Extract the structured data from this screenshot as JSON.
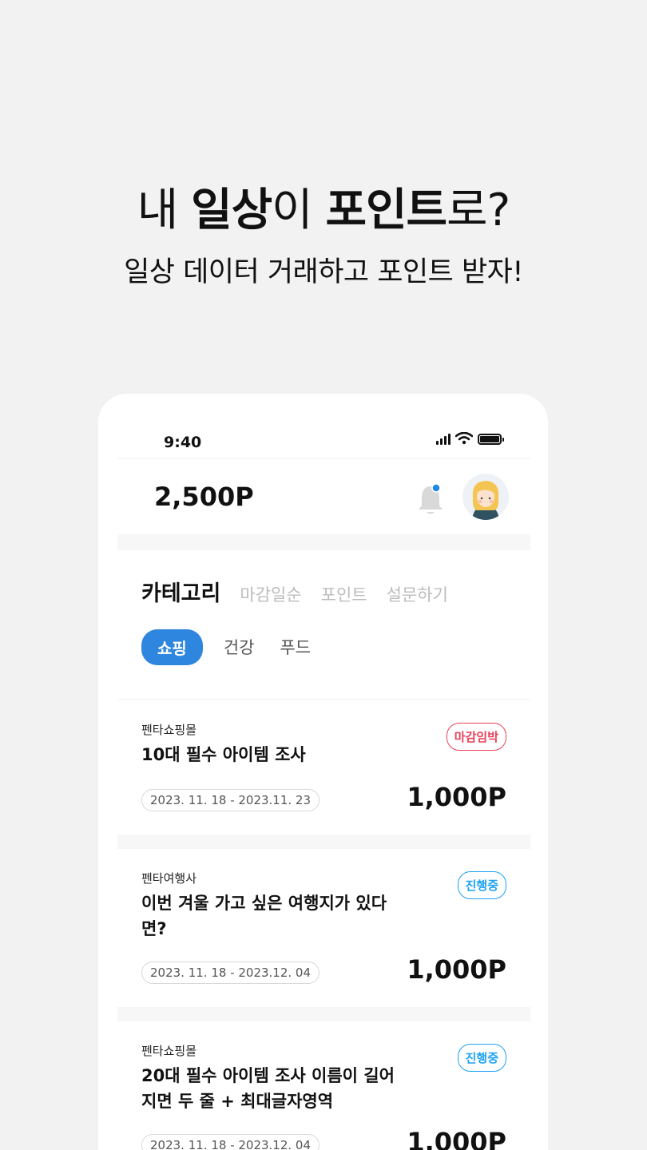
{
  "promo": {
    "headline_pre": "내 ",
    "headline_b1": "일상",
    "headline_mid": "이 ",
    "headline_b2": "포인트",
    "headline_post": "로?",
    "subline": "일상 데이터 거래하고 포인트 받자!"
  },
  "status_bar": {
    "time": "9:40"
  },
  "header": {
    "points": "2,500P",
    "notification_dot_color": "#1e88e5"
  },
  "tabs": {
    "active": "카테고리",
    "items": [
      "마감일순",
      "포인트",
      "설문하기"
    ]
  },
  "chips": {
    "active": "쇼핑",
    "items": [
      "건강",
      "푸드"
    ]
  },
  "colors": {
    "accent": "#2f86de",
    "urgent": "#e8405a",
    "progress": "#1ea2f2"
  },
  "surveys": [
    {
      "company": "펜타쇼핑몰",
      "title": "10대 필수 아이템 조사",
      "status": "마감임박",
      "date_range": "2023. 11. 18 - 2023.11. 23",
      "reward": "1,000P"
    },
    {
      "company": "펜타여행사",
      "title": "이번 겨울 가고 싶은 여행지가 있다면?",
      "status": "진행중",
      "date_range": "2023. 11. 18 - 2023.12. 04",
      "reward": "1,000P"
    },
    {
      "company": "펜타쇼핑몰",
      "title": "20대 필수 아이템 조사 이름이 길어지면 두 줄 + 최대글자영역",
      "status": "진행중",
      "date_range": "2023. 11. 18 - 2023.12. 04",
      "reward": "1,000P"
    }
  ]
}
